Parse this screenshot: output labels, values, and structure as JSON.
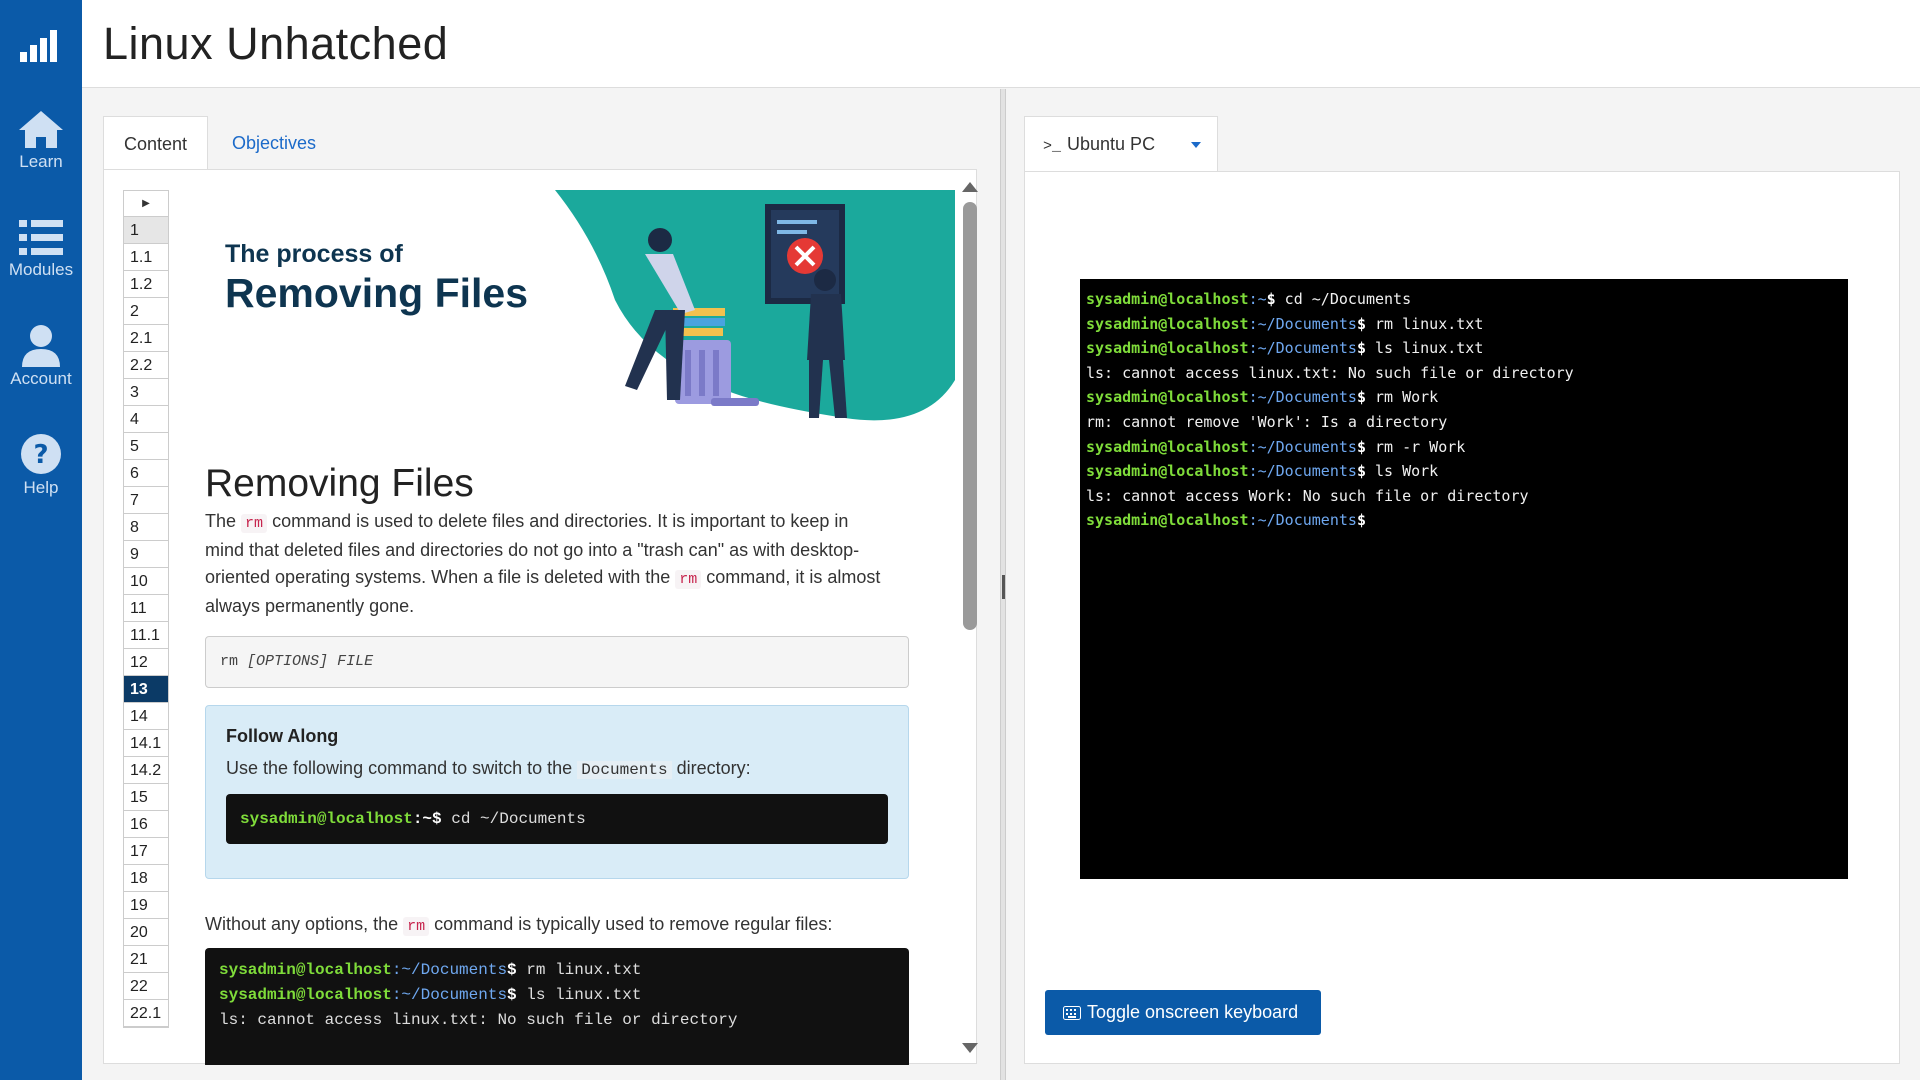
{
  "app": {
    "title": "Linux Unhatched"
  },
  "sidebar": {
    "items": [
      {
        "label": "Learn",
        "icon": "home-icon"
      },
      {
        "label": "Modules",
        "icon": "list-icon"
      },
      {
        "label": "Account",
        "icon": "user-icon"
      },
      {
        "label": "Help",
        "icon": "help-icon"
      }
    ]
  },
  "left": {
    "tabs": [
      "Content",
      "Objectives"
    ],
    "outline": [
      "1",
      "1.1",
      "1.2",
      "2",
      "2.1",
      "2.2",
      "3",
      "4",
      "5",
      "6",
      "7",
      "8",
      "9",
      "10",
      "11",
      "11.1",
      "12",
      "13",
      "14",
      "14.1",
      "14.2",
      "15",
      "16",
      "17",
      "18",
      "19",
      "20",
      "21",
      "22",
      "22.1"
    ],
    "outline_current": "13",
    "hero": {
      "small": "The process of",
      "big": "Removing Files"
    },
    "heading": "Removing Files",
    "para1": {
      "a": "The",
      "code": "rm",
      "b": "command is used to delete files and directories. It is important to keep in",
      "c": "mind that deleted files and directories do not go into a \"trash can\" as with desktop-",
      "d": "oriented operating systems. When a file is deleted with the",
      "e": "command, it is almost",
      "f": "always permanently gone."
    },
    "syntax": {
      "cmd": "rm",
      "opts": "[OPTIONS]",
      "file": "FILE"
    },
    "follow": {
      "title": "Follow Along",
      "text_a": "Use the following command to switch to the",
      "code": "Documents",
      "text_b": "directory:",
      "prompt_user": "sysadmin@localhost",
      "prompt_path": ":~$",
      "command": " cd ~/Documents"
    },
    "para2": {
      "a": "Without any options, the",
      "code": "rm",
      "b": "command is typically used to remove regular files:"
    },
    "example": [
      {
        "user": "sysadmin@localhost",
        "path": ":~/Documents",
        "sym": "$",
        "cmd": " rm linux.txt"
      },
      {
        "user": "sysadmin@localhost",
        "path": ":~/Documents",
        "sym": "$",
        "cmd": " ls linux.txt"
      },
      {
        "out": "ls: cannot access linux.txt: No such file or directory"
      }
    ]
  },
  "right": {
    "tab_prompt": ">_",
    "tab_label": "Ubuntu PC",
    "terminal": [
      {
        "user": "sysadmin@localhost",
        "path": ":~",
        "sym": "$",
        "cmd": " cd ~/Documents"
      },
      {
        "user": "sysadmin@localhost",
        "path": ":~/Documents",
        "sym": "$",
        "cmd": " rm linux.txt"
      },
      {
        "user": "sysadmin@localhost",
        "path": ":~/Documents",
        "sym": "$",
        "cmd": " ls linux.txt"
      },
      {
        "out": "ls: cannot access linux.txt: No such file or directory"
      },
      {
        "user": "sysadmin@localhost",
        "path": ":~/Documents",
        "sym": "$",
        "cmd": " rm Work"
      },
      {
        "out": "rm: cannot remove 'Work': Is a directory"
      },
      {
        "user": "sysadmin@localhost",
        "path": ":~/Documents",
        "sym": "$",
        "cmd": " rm -r Work"
      },
      {
        "user": "sysadmin@localhost",
        "path": ":~/Documents",
        "sym": "$",
        "cmd": " ls Work"
      },
      {
        "out": "ls: cannot access Work: No such file or directory"
      },
      {
        "user": "sysadmin@localhost",
        "path": ":~/Documents",
        "sym": "$",
        "cmd": ""
      }
    ],
    "keyboard_button": "Toggle onscreen keyboard"
  },
  "colors": {
    "sidebar": "#0b5aa8",
    "prompt_user": "#7fdc3a",
    "prompt_path": "#6fa8f0",
    "current_section": "#0b3a66"
  }
}
